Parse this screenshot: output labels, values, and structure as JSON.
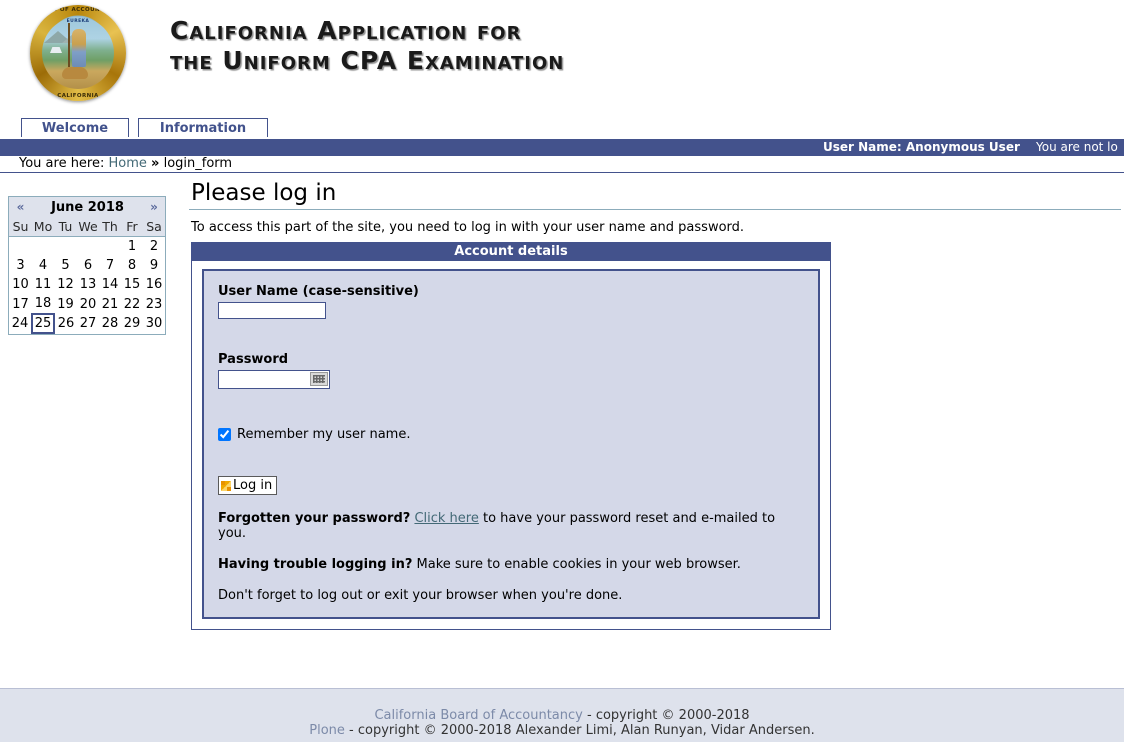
{
  "header": {
    "title_line1": "California Application for",
    "title_line2": "the Uniform CPA Examination",
    "seal_top": "BOARD OF ACCOUNTANCY",
    "seal_mid": "EUREKA",
    "seal_bottom": "CALIFORNIA"
  },
  "tabs": [
    {
      "label": "Welcome",
      "name": "tab-welcome"
    },
    {
      "label": "Information",
      "name": "tab-information"
    }
  ],
  "userbar": {
    "user_name": "User Name: Anonymous User",
    "login_status": "You are not lo"
  },
  "breadcrumb": {
    "prefix": "You are here:",
    "home": "Home",
    "separator": "»",
    "current": "login_form"
  },
  "calendar": {
    "prev": "«",
    "next": "»",
    "month_year": "June 2018",
    "dow": [
      "Su",
      "Mo",
      "Tu",
      "We",
      "Th",
      "Fr",
      "Sa"
    ],
    "weeks": [
      [
        "",
        "",
        "",
        "",
        "",
        "1",
        "2"
      ],
      [
        "3",
        "4",
        "5",
        "6",
        "7",
        "8",
        "9"
      ],
      [
        "10",
        "11",
        "12",
        "13",
        "14",
        "15",
        "16"
      ],
      [
        "17",
        "18",
        "19",
        "20",
        "21",
        "22",
        "23"
      ],
      [
        "24",
        "25",
        "26",
        "27",
        "28",
        "29",
        "30"
      ]
    ],
    "today": "25"
  },
  "main": {
    "page_title": "Please log in",
    "description": "To access this part of the site, you need to log in with your user name and password.",
    "form_header": "Account details",
    "username_label": "User Name (case-sensitive)",
    "username_value": "",
    "password_label": "Password",
    "password_value": "",
    "virtual_keyboard_icon": "keyboard-icon",
    "remember_label": "Remember my user name.",
    "remember_checked": true,
    "login_button": "Log in",
    "forgot_bold": "Forgotten your password?",
    "forgot_link": "Click here",
    "forgot_rest": " to have your password reset and e-mailed to you.",
    "trouble_bold": "Having trouble logging in?",
    "trouble_rest": " Make sure to enable cookies in your web browser.",
    "logout_note": "Don't forget to log out or exit your browser when you're done."
  },
  "footer": {
    "line1_link": "California Board of Accountancy",
    "line1_rest": " - copyright © 2000-2018",
    "line2_link": "Plone",
    "line2_rest": " - copyright © 2000-2018 Alexander Limi, Alan Runyan, Vidar Andersen."
  },
  "colors": {
    "accent": "#43528c",
    "form_bg": "#d4d8e8",
    "footer_bg": "#dee2ec",
    "link": "#436976"
  }
}
